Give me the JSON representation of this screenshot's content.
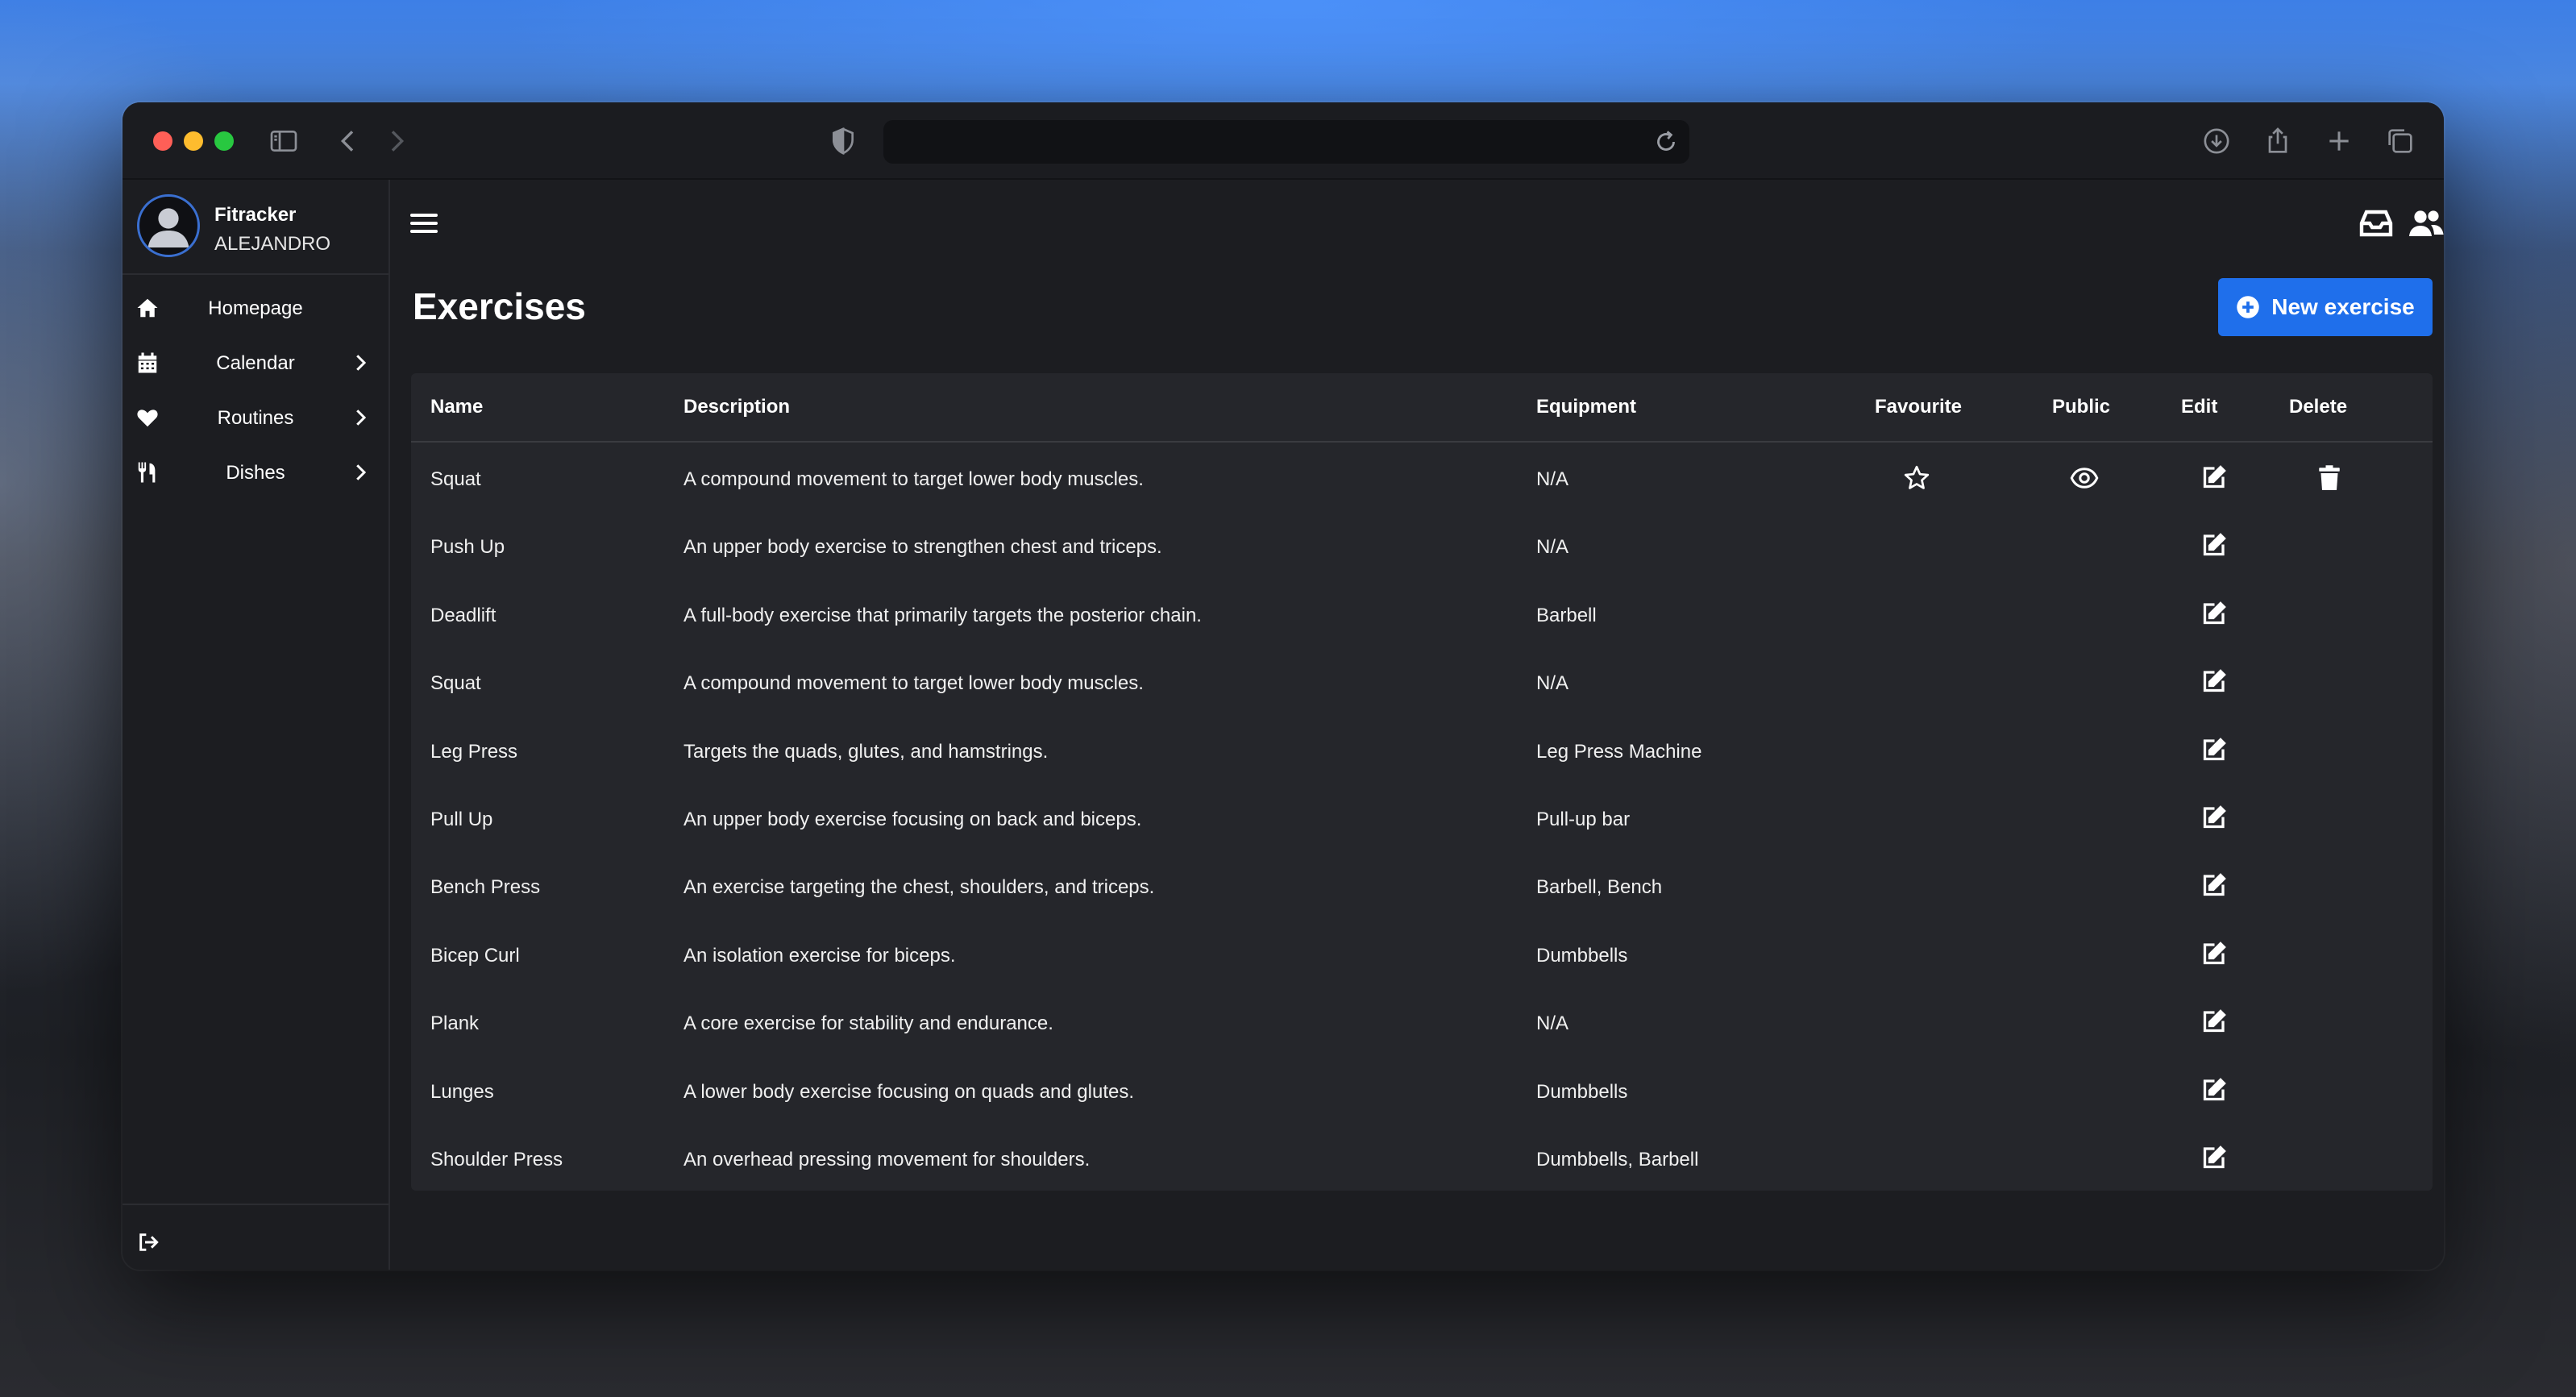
{
  "browser": {
    "url": ""
  },
  "sidebar": {
    "app_name": "Fitracker",
    "user_name": "ALEJANDRO",
    "items": [
      {
        "label": "Homepage",
        "icon": "home-icon",
        "has_chevron": false
      },
      {
        "label": "Calendar",
        "icon": "calendar-icon",
        "has_chevron": true
      },
      {
        "label": "Routines",
        "icon": "heart-icon",
        "has_chevron": true
      },
      {
        "label": "Dishes",
        "icon": "utensils-icon",
        "has_chevron": true
      }
    ]
  },
  "header": {
    "title": "Exercises",
    "new_button_label": "New exercise"
  },
  "table": {
    "columns": {
      "name": "Name",
      "description": "Description",
      "equipment": "Equipment",
      "favourite": "Favourite",
      "public": "Public",
      "edit": "Edit",
      "delete": "Delete"
    },
    "rows": [
      {
        "name": "Squat",
        "description": "A compound movement to target lower body muscles.",
        "equipment": "N/A",
        "own": true
      },
      {
        "name": "Push Up",
        "description": "An upper body exercise to strengthen chest and triceps.",
        "equipment": "N/A",
        "own": false
      },
      {
        "name": "Deadlift",
        "description": "A full-body exercise that primarily targets the posterior chain.",
        "equipment": "Barbell",
        "own": false
      },
      {
        "name": "Squat",
        "description": "A compound movement to target lower body muscles.",
        "equipment": "N/A",
        "own": false
      },
      {
        "name": "Leg Press",
        "description": "Targets the quads, glutes, and hamstrings.",
        "equipment": "Leg Press Machine",
        "own": false
      },
      {
        "name": "Pull Up",
        "description": "An upper body exercise focusing on back and biceps.",
        "equipment": "Pull-up bar",
        "own": false
      },
      {
        "name": "Bench Press",
        "description": "An exercise targeting the chest, shoulders, and triceps.",
        "equipment": "Barbell, Bench",
        "own": false
      },
      {
        "name": "Bicep Curl",
        "description": "An isolation exercise for biceps.",
        "equipment": "Dumbbells",
        "own": false
      },
      {
        "name": "Plank",
        "description": "A core exercise for stability and endurance.",
        "equipment": "N/A",
        "own": false
      },
      {
        "name": "Lunges",
        "description": "A lower body exercise focusing on quads and glutes.",
        "equipment": "Dumbbells",
        "own": false
      },
      {
        "name": "Shoulder Press",
        "description": "An overhead pressing movement for shoulders.",
        "equipment": "Dumbbells, Barbell",
        "own": false
      }
    ]
  },
  "colors": {
    "accent": "#1f6feb",
    "background": "#1c1d21",
    "table_background": "#25262b"
  }
}
